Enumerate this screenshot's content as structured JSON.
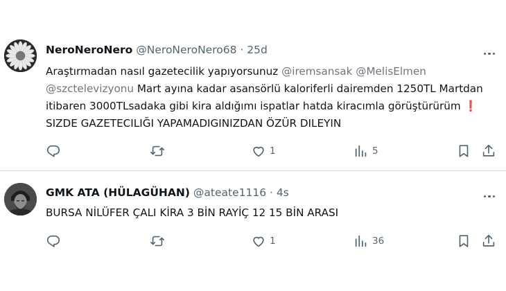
{
  "tweets": [
    {
      "display_name": "NeroNeroNero",
      "handle": "@NeroNeroNero68",
      "separator": "·",
      "time": "25d",
      "text_1": "Araştırmadan nasıl gazetecilik yapıyorsunuz ",
      "mention_1": "@iremsansak",
      "mention_2": "@MelisElmen",
      "mention_3": "@szctelevizyonu",
      "text_2": "  Mart ayına kadar asansörlü kaloriferli dairemden 1250TL Martdan itibaren 3000TLsadaka gibi kira aldığımı ispatlar hatda kiracımla görüştürürüm ",
      "emoji": "❗",
      "text_3": " SIZDE GAZETECILIĞI YAPAMADIGINIZDAN ÖZÜR DILEYIN",
      "replies": "",
      "reposts": "",
      "likes": "1",
      "views": "5"
    },
    {
      "display_name": "GMK ATA (HÜLAGÜHAN)",
      "handle": "@ateate1116",
      "separator": "·",
      "time": "4s",
      "text": "BURSA NİLÜFER ÇALI KİRA 3 BİN RAYİÇ 12 15 BİN ARASI",
      "replies": "",
      "reposts": "",
      "likes": "1",
      "views": "36"
    }
  ],
  "icons": {
    "avatar_1": "daisy-flower-avatar",
    "avatar_2": "warrior-portrait-avatar",
    "more": "more-horizontal-icon",
    "reply": "reply-icon",
    "repost": "repost-icon",
    "like": "heart-icon",
    "views": "views-bar-chart-icon",
    "bookmark": "bookmark-icon",
    "share": "share-icon"
  },
  "colors": {
    "text": "#0f1419",
    "secondary": "#536471",
    "mention": "#6e767d",
    "divider": "#d6d6d6"
  }
}
